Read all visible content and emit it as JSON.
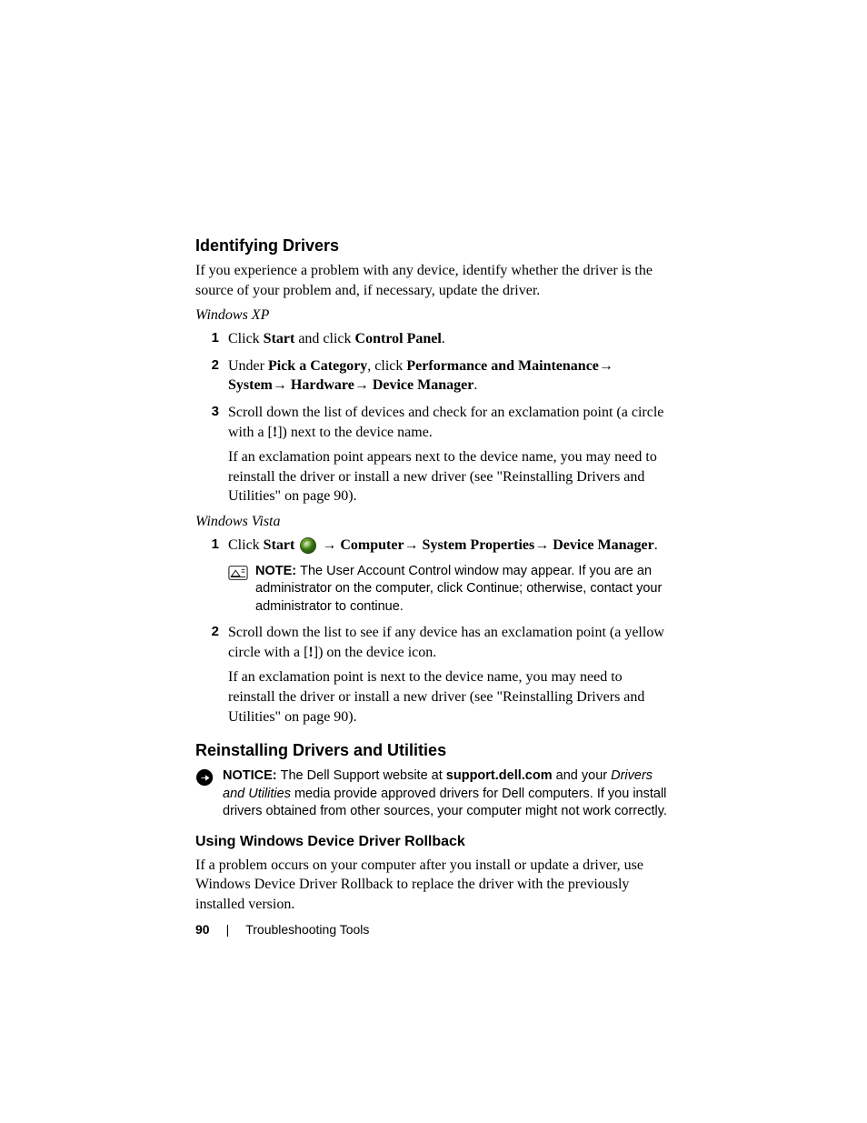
{
  "footer": {
    "page_number": "90",
    "separator": "|",
    "section": "Troubleshooting Tools"
  },
  "h_identifying": "Identifying Drivers",
  "p_identifying_intro": "If you experience a problem with any device, identify whether the driver is the source of your problem and, if necessary, update the driver.",
  "xp_label": "Windows XP",
  "xp_steps": {
    "s1_num": "1",
    "s1_a": "Click ",
    "s1_b": "Start",
    "s1_c": " and click ",
    "s1_d": "Control Panel",
    "s1_e": ".",
    "s2_num": "2",
    "s2_a": "Under ",
    "s2_b": "Pick a Category",
    "s2_c": ", click ",
    "s2_d": "Performance and Maintenance",
    "s2_e": "→ ",
    "s2_f": "System",
    "s2_g": "→ ",
    "s2_h": "Hardware",
    "s2_i": "→ ",
    "s2_j": "Device Manager",
    "s2_k": ".",
    "s3_num": "3",
    "s3_a": "Scroll down the list of devices and check for an exclamation point (a circle with a [",
    "s3_b": "!",
    "s3_c": "]) next to the device name.",
    "s3_follow": "If an exclamation point appears next to the device name, you may need to reinstall the driver or install a new driver (see \"Reinstalling Drivers and Utilities\" on page 90)."
  },
  "vista_label": "Windows Vista",
  "vista_steps": {
    "s1_num": "1",
    "s1_a": "Click ",
    "s1_b": "Start",
    "s1_c": " → ",
    "s1_d": "Computer",
    "s1_e": "→ ",
    "s1_f": "System Properties",
    "s1_g": "→ ",
    "s1_h": "Device Manager",
    "s1_i": ".",
    "s2_num": "2",
    "s2_a": "Scroll down the list to see if any device has an exclamation point (a yellow circle with a [",
    "s2_b": "!",
    "s2_c": "]) on the device icon.",
    "s2_follow": "If an exclamation point is next to the device name, you may need to reinstall the driver or install a new driver (see \"Reinstalling Drivers and Utilities\" on page 90)."
  },
  "note1": {
    "label": "NOTE: ",
    "a": "The ",
    "b": "User Account Control",
    "c": " window may appear. If you are an administrator on the computer, click ",
    "d": "Continue",
    "e": "; otherwise, contact your administrator to continue."
  },
  "h_reinstall": "Reinstalling Drivers and Utilities",
  "notice1": {
    "label": "NOTICE: ",
    "a": "The Dell Support website at ",
    "b": "support.dell.com",
    "c": " and your ",
    "d": "Drivers and Utilities",
    "e": " media provide approved drivers for Dell computers. If you install drivers obtained from other sources, your computer might not work correctly."
  },
  "h_rollback": "Using Windows Device Driver Rollback",
  "p_rollback": "If a problem occurs on your computer after you install or update a driver, use Windows Device Driver Rollback to replace the driver with the previously installed version."
}
